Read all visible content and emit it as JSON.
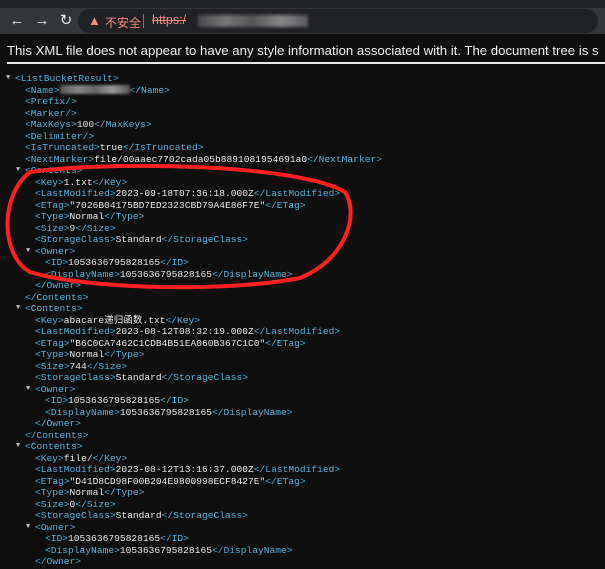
{
  "browser": {
    "nav": {
      "back_icon": "arrow-left",
      "forward_icon": "arrow-right",
      "reload_icon": "reload"
    },
    "security_icon": "warning-triangle",
    "security_label": "不安全",
    "url_prefix": "https:/",
    "accent_insecure": "#f28b82"
  },
  "banner": "This XML file does not appear to have any style information associated with it. The document tree is s",
  "colors": {
    "tag": "#5aaed6",
    "text": "#e8e8e8",
    "annotation": "#ff2020"
  },
  "xml_lines": [
    {
      "d": 0,
      "toggle": true,
      "o": "<ListBucketResult>"
    },
    {
      "d": 1,
      "o": "<Name>",
      "blur": true,
      "c": "</Name>"
    },
    {
      "d": 1,
      "o": "<Prefix/>"
    },
    {
      "d": 1,
      "o": "<Marker/>"
    },
    {
      "d": 1,
      "o": "<MaxKeys>",
      "t": "100",
      "c": "</MaxKeys>"
    },
    {
      "d": 1,
      "o": "<Delimiter/>"
    },
    {
      "d": 1,
      "o": "<IsTruncated>",
      "t": "true",
      "c": "</IsTruncated>"
    },
    {
      "d": 1,
      "o": "<NextMarker>",
      "t": "file/00aaec7702cada05b8891081954691a0",
      "c": "</NextMarker>"
    },
    {
      "d": 1,
      "toggle": true,
      "o": "<Contents>"
    },
    {
      "d": 2,
      "o": "<Key>",
      "t": "1.txt",
      "c": "</Key>"
    },
    {
      "d": 2,
      "o": "<LastModified>",
      "t": "2023-09-18T07:36:18.000Z",
      "c": "</LastModified>"
    },
    {
      "d": 2,
      "o": "<ETag>",
      "t": "\"7026B04175BD7ED2323CBD79A4E86F7E\"",
      "c": "</ETag>"
    },
    {
      "d": 2,
      "o": "<Type>",
      "t": "Normal",
      "c": "</Type>"
    },
    {
      "d": 2,
      "o": "<Size>",
      "t": "9",
      "c": "</Size>"
    },
    {
      "d": 2,
      "o": "<StorageClass>",
      "t": "Standard",
      "c": "</StorageClass>"
    },
    {
      "d": 2,
      "toggle": true,
      "o": "<Owner>"
    },
    {
      "d": 3,
      "o": "<ID>",
      "t": "1053636795828165",
      "c": "</ID>"
    },
    {
      "d": 3,
      "o": "<DisplayName>",
      "t": "1053636795828165",
      "c": "</DisplayName>"
    },
    {
      "d": 2,
      "o": "</Owner>"
    },
    {
      "d": 1,
      "o": "</Contents>"
    },
    {
      "d": 1,
      "toggle": true,
      "o": "<Contents>"
    },
    {
      "d": 2,
      "o": "<Key>",
      "t": "abacare递归函数.txt",
      "c": "</Key>"
    },
    {
      "d": 2,
      "o": "<LastModified>",
      "t": "2023-08-12T08:32:19.000Z",
      "c": "</LastModified>"
    },
    {
      "d": 2,
      "o": "<ETag>",
      "t": "\"B6C0CA7462C1CDB4B51EA060B367C1C0\"",
      "c": "</ETag>"
    },
    {
      "d": 2,
      "o": "<Type>",
      "t": "Normal",
      "c": "</Type>"
    },
    {
      "d": 2,
      "o": "<Size>",
      "t": "744",
      "c": "</Size>"
    },
    {
      "d": 2,
      "o": "<StorageClass>",
      "t": "Standard",
      "c": "</StorageClass>"
    },
    {
      "d": 2,
      "toggle": true,
      "o": "<Owner>"
    },
    {
      "d": 3,
      "o": "<ID>",
      "t": "1053636795828165",
      "c": "</ID>"
    },
    {
      "d": 3,
      "o": "<DisplayName>",
      "t": "1053636795828165",
      "c": "</DisplayName>"
    },
    {
      "d": 2,
      "o": "</Owner>"
    },
    {
      "d": 1,
      "o": "</Contents>"
    },
    {
      "d": 1,
      "toggle": true,
      "o": "<Contents>"
    },
    {
      "d": 2,
      "o": "<Key>",
      "t": "file/",
      "c": "</Key>"
    },
    {
      "d": 2,
      "o": "<LastModified>",
      "t": "2023-08-12T13:16:37.000Z",
      "c": "</LastModified>"
    },
    {
      "d": 2,
      "o": "<ETag>",
      "t": "\"D41D8CD98F00B204E9800998ECF8427E\"",
      "c": "</ETag>"
    },
    {
      "d": 2,
      "o": "<Type>",
      "t": "Normal",
      "c": "</Type>"
    },
    {
      "d": 2,
      "o": "<Size>",
      "t": "0",
      "c": "</Size>"
    },
    {
      "d": 2,
      "o": "<StorageClass>",
      "t": "Standard",
      "c": "</StorageClass>"
    },
    {
      "d": 2,
      "toggle": true,
      "o": "<Owner>"
    },
    {
      "d": 3,
      "o": "<ID>",
      "t": "1053636795828165",
      "c": "</ID>"
    },
    {
      "d": 3,
      "o": "<DisplayName>",
      "t": "1053636795828165",
      "c": "</DisplayName>"
    },
    {
      "d": 2,
      "o": "</Owner>"
    }
  ]
}
